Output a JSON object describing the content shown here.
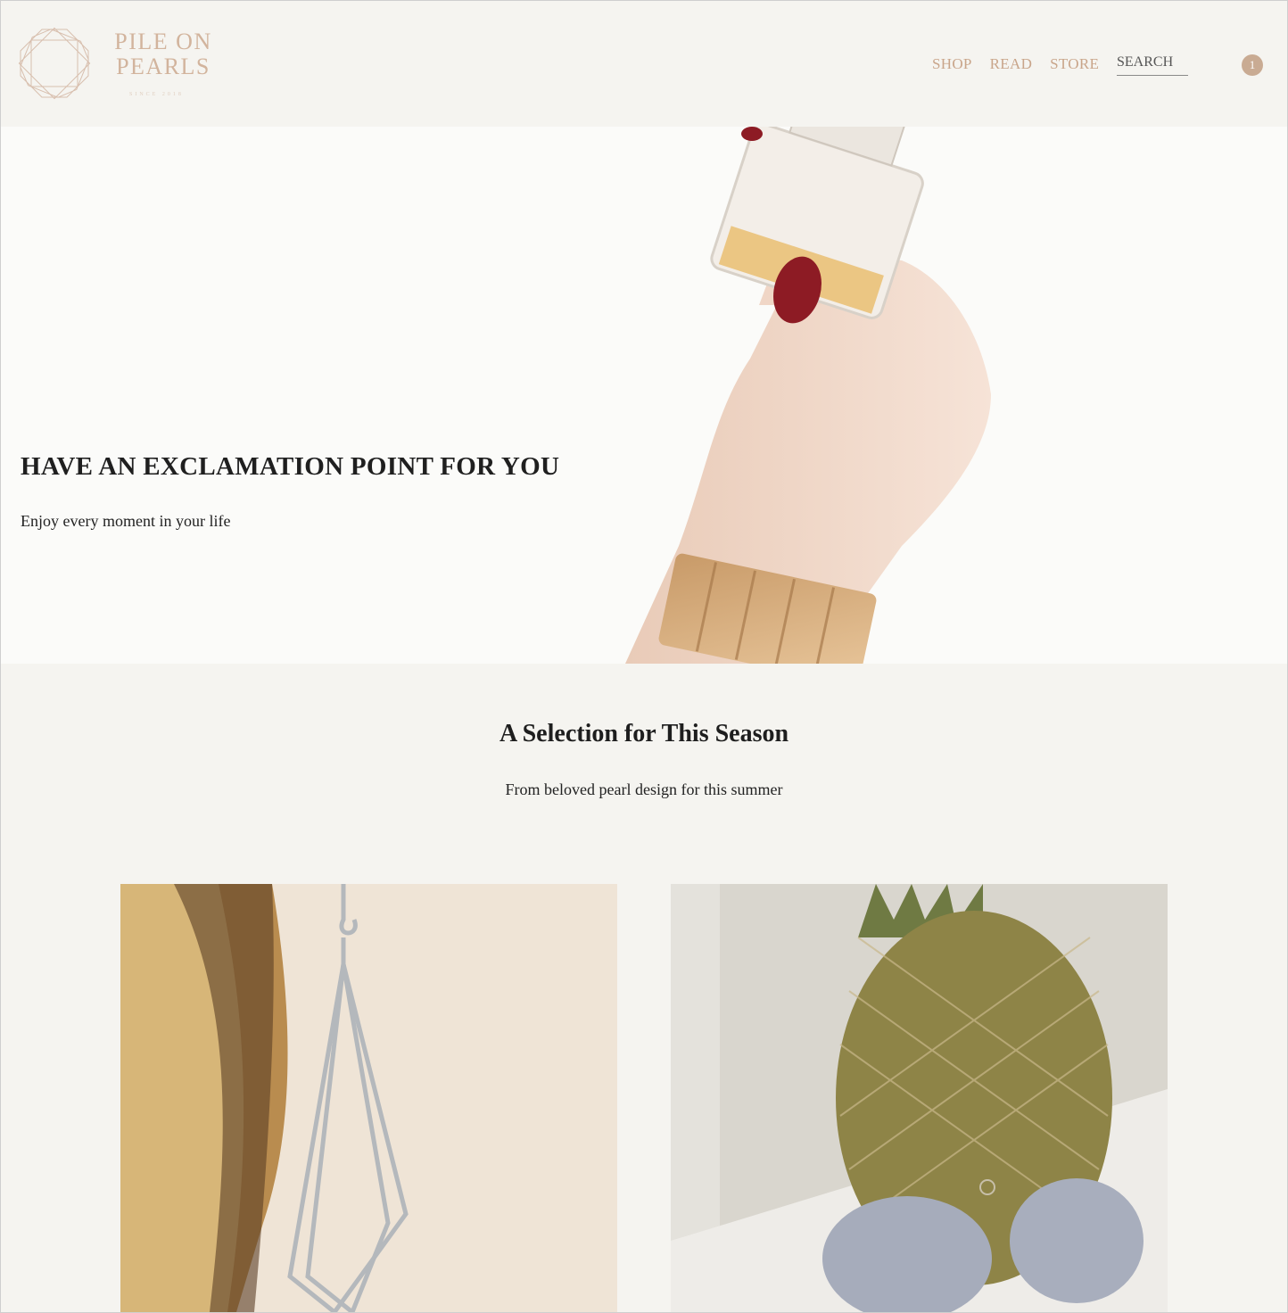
{
  "brand": {
    "line1": "PILE ON",
    "line2": "PEARLS",
    "tagline": "SINCE 2018",
    "color": "#d2b49d"
  },
  "nav": {
    "items": [
      {
        "label": "SHOP"
      },
      {
        "label": "READ"
      },
      {
        "label": "STORE"
      }
    ],
    "search_placeholder": "SEARCH",
    "cart_count": "1",
    "accent": "#c9a58a"
  },
  "hero": {
    "title": "HAVE AN EXCLAMATION POINT FOR YOU",
    "subtitle": "Enjoy every moment in your life",
    "image": "hand-with-perfume-bottle"
  },
  "section": {
    "title": "A Selection for This Season",
    "subtitle": "From beloved pearl design for this summer"
  },
  "products": [
    {
      "image": "geometric-silver-earring"
    },
    {
      "image": "pineapple-with-fur-hoop-earrings"
    }
  ]
}
